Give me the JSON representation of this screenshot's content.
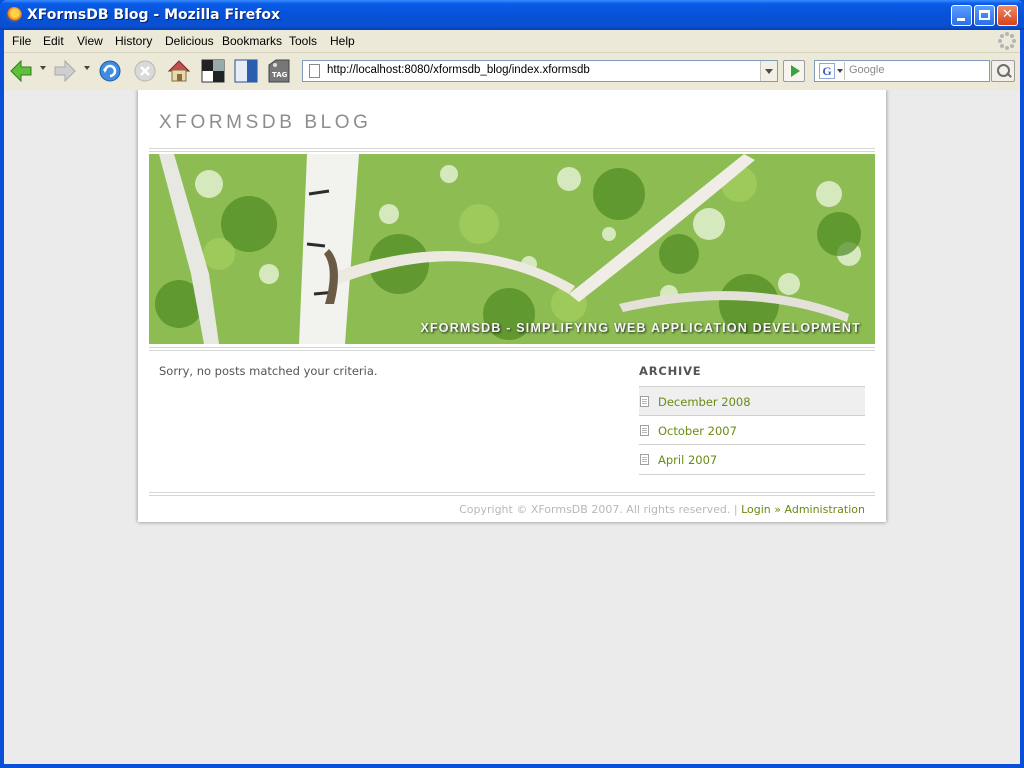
{
  "window": {
    "title": "XFormsDB Blog - Mozilla Firefox"
  },
  "menubar": {
    "items": [
      "File",
      "Edit",
      "View",
      "History",
      "Delicious",
      "Bookmarks",
      "Tools",
      "Help"
    ]
  },
  "navbar": {
    "url": "http://localhost:8080/xformsdb_blog/index.xformsdb",
    "search_placeholder": "Google",
    "search_engine_letter": "G",
    "tag_label": "TAG"
  },
  "page": {
    "blog_title": "XFORMSDB BLOG",
    "banner_caption": "XFORMSDB - SIMPLIFYING WEB APPLICATION DEVELOPMENT",
    "no_posts_message": "Sorry, no posts matched your criteria.",
    "archive": {
      "heading": "ARCHIVE",
      "items": [
        "December 2008",
        "October 2007",
        "April 2007"
      ]
    },
    "footer": {
      "copyright": "Copyright © XFormsDB 2007. All rights reserved.",
      "separator": "|",
      "login_label": "Login",
      "arrow": "»",
      "admin_label": "Administration"
    }
  },
  "colors": {
    "link_green": "#6a8a12",
    "page_bg": "#ebebeb",
    "title_gray": "#8d8d8d"
  }
}
